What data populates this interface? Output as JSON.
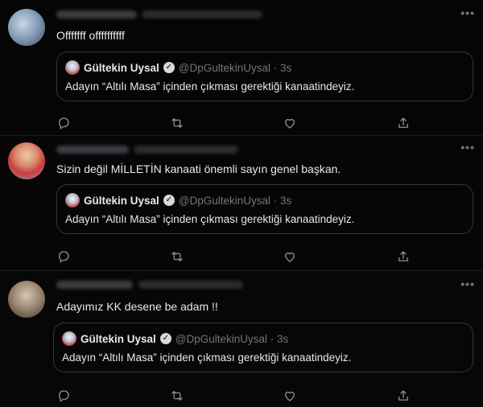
{
  "more_label": "•••",
  "tweets": [
    {
      "text": "Offfffff offffffffff",
      "quote": {
        "name": "Gültekin Uysal",
        "handle": "@DpGultekinUysal · 3s",
        "text": "Adayın “Altılı Masa” içinden çıkması gerektiği kanaatindeyiz."
      }
    },
    {
      "text": "Sizin değil MİLLETİN kanaati önemli sayın genel başkan.",
      "quote": {
        "name": "Gültekin Uysal",
        "handle": "@DpGultekinUysal · 3s",
        "text": "Adayın “Altılı Masa” içinden çıkması gerektiği kanaatindeyiz."
      }
    },
    {
      "text": "Adayımız KK desene be adam !!",
      "quote": {
        "name": "Gültekin Uysal",
        "handle": "@DpGultekinUysal · 3s",
        "text": "Adayın “Altılı Masa” içinden çıkması gerektiği kanaatindeyiz."
      }
    }
  ],
  "icons": {
    "reply": "reply-icon",
    "retweet": "retweet-icon",
    "like": "like-icon",
    "share": "share-icon",
    "verified": "verified-badge-icon"
  },
  "colors": {
    "background": "#000000",
    "text": "#e7e9ea",
    "muted": "#71767b",
    "border": "#333639"
  }
}
